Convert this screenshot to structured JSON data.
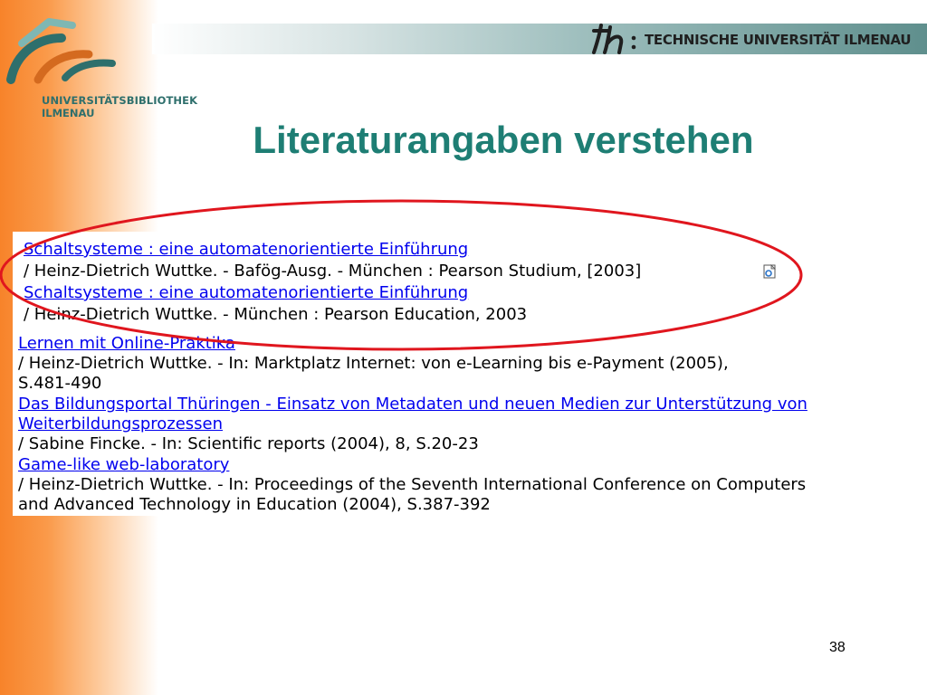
{
  "header": {
    "library_name_line1": "UNIVERSITÄTSBIBLIOTHEK",
    "library_name_line2": "ILMENAU",
    "university_name": "TECHNISCHE UNIVERSITÄT ILMENAU"
  },
  "slide": {
    "title": "Literaturangaben verstehen",
    "page_number": "38"
  },
  "results": [
    {
      "link": "Schaltsysteme : eine automatenorientierte Einführung",
      "detail": "/ Heinz-Dietrich Wuttke. - Bafög-Ausg. - München : Pearson Studium, [2003]"
    },
    {
      "link": "Schaltsysteme : eine automatenorientierte Einführung",
      "detail": "/ Heinz-Dietrich Wuttke. - München : Pearson Education, 2003"
    },
    {
      "link": "Lernen mit Online-Praktika",
      "detail": "/ Heinz-Dietrich Wuttke. - In: Marktplatz Internet: von e-Learning bis e-Payment (2005),",
      "detail2": "S.481-490"
    },
    {
      "link": "Das Bildungsportal Thüringen - Einsatz von Metadaten und neuen Medien zur Unterstützung von",
      "link2": "Weiterbildungsprozessen",
      "detail": "/ Sabine Fincke. - In: Scientific reports (2004), 8, S.20-23"
    },
    {
      "link": "Game-like web-laboratory",
      "detail": "/ Heinz-Dietrich Wuttke. - In: Proceedings of the Seventh International Conference on Computers",
      "detail2": "and Advanced Technology in Education (2004), S.387-392"
    }
  ],
  "icons": {
    "document_icon": "document-icon",
    "library_logo": "library-logo-icon",
    "university_logo": "university-logo-icon"
  },
  "colors": {
    "title": "#1e7e74",
    "link": "#0000ee",
    "highlight_ellipse": "#e0161e",
    "orange_band": "#f7832a"
  }
}
